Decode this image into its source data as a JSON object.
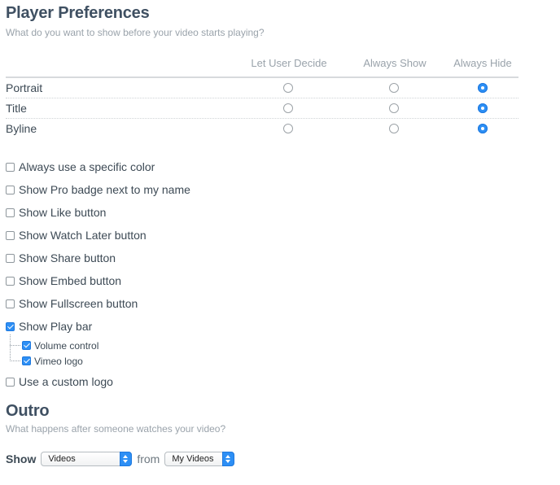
{
  "player_preferences": {
    "title": "Player Preferences",
    "subtitle": "What do you want to show before your video starts playing?",
    "columns": [
      "Let User Decide",
      "Always Show",
      "Always Hide"
    ],
    "rows": [
      {
        "label": "Portrait",
        "selected": 2
      },
      {
        "label": "Title",
        "selected": 2
      },
      {
        "label": "Byline",
        "selected": 2
      }
    ]
  },
  "options": [
    {
      "label": "Always use a specific color",
      "checked": false
    },
    {
      "label": "Show Pro badge next to my name",
      "checked": false
    },
    {
      "label": "Show Like button",
      "checked": false
    },
    {
      "label": "Show Watch Later button",
      "checked": false
    },
    {
      "label": "Show Share button",
      "checked": false
    },
    {
      "label": "Show Embed button",
      "checked": false
    },
    {
      "label": "Show Fullscreen button",
      "checked": false
    },
    {
      "label": "Show Play bar",
      "checked": true
    }
  ],
  "play_bar_suboptions": [
    {
      "label": "Volume control",
      "checked": true
    },
    {
      "label": "Vimeo logo",
      "checked": true
    }
  ],
  "custom_logo": {
    "label": "Use a custom logo",
    "checked": false
  },
  "outro": {
    "title": "Outro",
    "subtitle": "What happens after someone watches your video?",
    "show_label": "Show",
    "from_label": "from",
    "content_select": "Videos",
    "source_select": "My Videos"
  },
  "colors": {
    "accent": "#2d8ff5",
    "heading": "#3f5062",
    "muted": "#9aa3ab"
  }
}
